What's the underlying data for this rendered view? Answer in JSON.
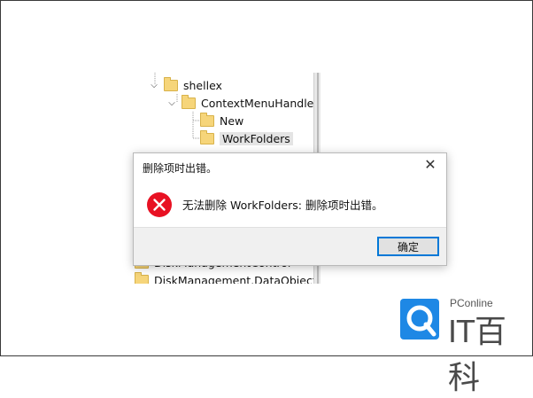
{
  "tree": {
    "items": [
      {
        "label": "shellex",
        "expanded": true
      },
      {
        "label": "ContextMenuHandle",
        "expanded": true
      },
      {
        "label": "New",
        "expanded": false
      },
      {
        "label": "WorkFolders",
        "expanded": false,
        "selected": true
      },
      {
        "label": "DiskManagementControl",
        "expanded": false
      },
      {
        "label": "DiskManagement.DataObject",
        "expanded": false
      }
    ]
  },
  "dialog": {
    "title": "删除项时出错。",
    "close_glyph": "✕",
    "message": "无法删除 WorkFolders: 删除项时出错。",
    "ok_label": "确定",
    "icon": "error-icon"
  },
  "watermark": {
    "brand_small": "PConline",
    "brand_big": "IT百科"
  },
  "colors": {
    "accent": "#0078d7",
    "error": "#e81123",
    "folder": "#f6d57a",
    "logo": "#1e88e5"
  }
}
